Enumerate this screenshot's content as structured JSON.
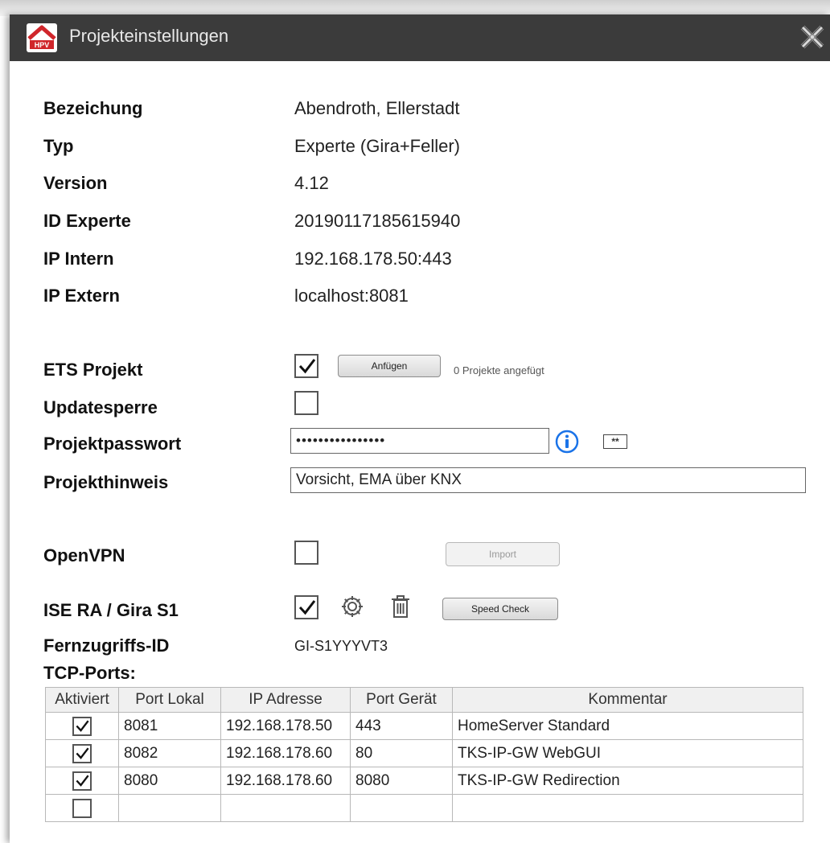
{
  "window": {
    "title": "Projekteinstellungen",
    "logo_text": "HPV"
  },
  "info": {
    "name_label": "Bezeichung",
    "name_value": "Abendroth, Ellerstadt",
    "type_label": "Typ",
    "type_value": "Experte (Gira+Feller)",
    "version_label": "Version",
    "version_value": "4.12",
    "id_label": "ID Experte",
    "id_value": "20190117185615940",
    "ip_int_label": "IP Intern",
    "ip_int_value": "192.168.178.50:443",
    "ip_ext_label": "IP Extern",
    "ip_ext_value": "localhost:8081"
  },
  "settings": {
    "ets_label": "ETS Projekt",
    "ets_checked": true,
    "attach_button": "Anfügen",
    "attached_status": "0 Projekte angefügt",
    "lock_label": "Updatesperre",
    "lock_checked": false,
    "password_label": "Projektpasswort",
    "password_value": "••••••••••••••••",
    "show_password_icon_text": "**",
    "hint_label": "Projekthinweis",
    "hint_value": "Vorsicht, EMA über KNX",
    "vpn_label": "OpenVPN",
    "vpn_checked": false,
    "import_button": "Import",
    "ise_label": "ISE RA / Gira S1",
    "ise_checked": true,
    "speed_button": "Speed Check",
    "remote_id_label": "Fernzugriffs-ID",
    "remote_id_value": "GI-S1YYYVT3",
    "tcp_label": "TCP-Ports:"
  },
  "ports": {
    "headers": [
      "Aktiviert",
      "Port Lokal",
      "IP Adresse",
      "Port Gerät",
      "Kommentar"
    ],
    "rows": [
      {
        "active": true,
        "local": "8081",
        "ip": "192.168.178.50",
        "device": "443",
        "comment": "HomeServer Standard"
      },
      {
        "active": true,
        "local": "8082",
        "ip": "192.168.178.60",
        "device": "80",
        "comment": "TKS-IP-GW WebGUI"
      },
      {
        "active": true,
        "local": "8080",
        "ip": "192.168.178.60",
        "device": "8080",
        "comment": "TKS-IP-GW Redirection"
      },
      {
        "active": false,
        "local": "",
        "ip": "",
        "device": "",
        "comment": ""
      }
    ]
  },
  "colors": {
    "titlebar": "#3b3b3b",
    "info_icon": "#1a73e8",
    "logo_red": "#d0262b"
  }
}
